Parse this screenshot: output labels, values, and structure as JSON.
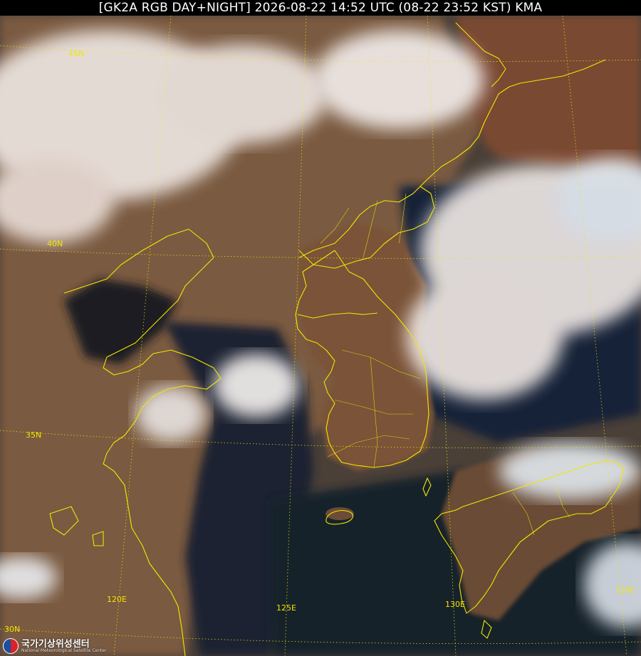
{
  "header": {
    "title": "[GK2A RGB DAY+NIGHT] 2026-08-22 14:52 UTC (08-22 23:52 KST) KMA"
  },
  "map": {
    "product": "GK2A RGB DAY+NIGHT",
    "graticule_color": "#f2e600",
    "coastline_color": "#f2e600",
    "lat_labels": [
      "45N",
      "40N",
      "35N",
      "30N"
    ],
    "lon_labels": [
      "120E",
      "125E",
      "130E",
      "135E"
    ]
  },
  "logo": {
    "korean": "국가기상위성센터",
    "english": "National Meteorological Satellite Center"
  },
  "colors": {
    "land": "#8a5a3c",
    "sea": "#142036",
    "cloud": "#eee6e0",
    "label": "#f2e600"
  }
}
